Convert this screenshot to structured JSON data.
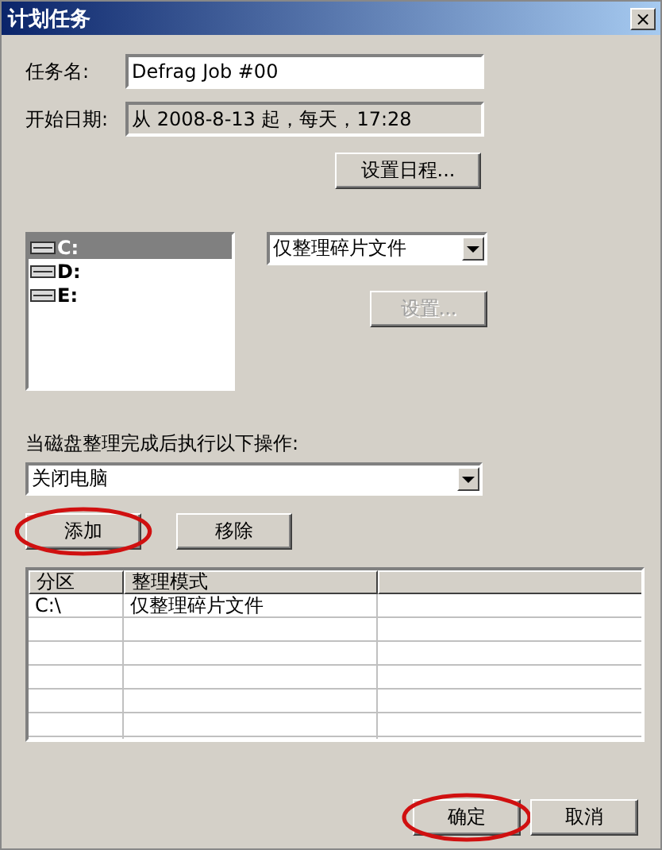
{
  "window": {
    "title": "计划任务",
    "close": "×"
  },
  "task_name": {
    "label": "任务名:",
    "value": "Defrag Job #00"
  },
  "start_date": {
    "label": "开始日期:",
    "value": "从 2008-8-13 起，每天，17:28"
  },
  "schedule_button": {
    "label": "设置日程...",
    "circled": false
  },
  "drives": [
    {
      "label": "C:",
      "selected": true
    },
    {
      "label": "D:",
      "selected": false
    },
    {
      "label": "E:",
      "selected": false
    }
  ],
  "mode_dropdown": {
    "value": "仅整理碎片文件"
  },
  "settings_button": {
    "label": "设置...",
    "disabled": true
  },
  "after_label": "当磁盘整理完成后执行以下操作:",
  "after_dropdown": {
    "value": "关闭电脑"
  },
  "add_button": {
    "label": "添加",
    "circled": true
  },
  "remove_button": {
    "label": "移除",
    "circled": false
  },
  "table": {
    "columns": [
      "分区",
      "整理模式"
    ],
    "rows": [
      {
        "cells": [
          "C:\\",
          "仅整理碎片文件"
        ]
      }
    ]
  },
  "footer_buttons": [
    {
      "label": "确定",
      "circled": true
    },
    {
      "label": "取消",
      "circled": false
    }
  ]
}
